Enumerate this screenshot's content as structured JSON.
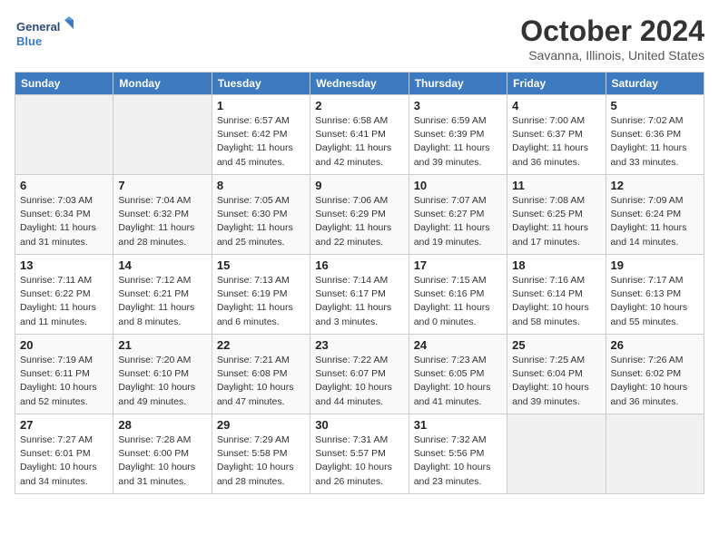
{
  "logo": {
    "line1": "General",
    "line2": "Blue"
  },
  "title": "October 2024",
  "location": "Savanna, Illinois, United States",
  "days_of_week": [
    "Sunday",
    "Monday",
    "Tuesday",
    "Wednesday",
    "Thursday",
    "Friday",
    "Saturday"
  ],
  "weeks": [
    [
      {
        "day": "",
        "empty": true
      },
      {
        "day": "",
        "empty": true
      },
      {
        "day": "1",
        "sunrise": "Sunrise: 6:57 AM",
        "sunset": "Sunset: 6:42 PM",
        "daylight": "Daylight: 11 hours and 45 minutes."
      },
      {
        "day": "2",
        "sunrise": "Sunrise: 6:58 AM",
        "sunset": "Sunset: 6:41 PM",
        "daylight": "Daylight: 11 hours and 42 minutes."
      },
      {
        "day": "3",
        "sunrise": "Sunrise: 6:59 AM",
        "sunset": "Sunset: 6:39 PM",
        "daylight": "Daylight: 11 hours and 39 minutes."
      },
      {
        "day": "4",
        "sunrise": "Sunrise: 7:00 AM",
        "sunset": "Sunset: 6:37 PM",
        "daylight": "Daylight: 11 hours and 36 minutes."
      },
      {
        "day": "5",
        "sunrise": "Sunrise: 7:02 AM",
        "sunset": "Sunset: 6:36 PM",
        "daylight": "Daylight: 11 hours and 33 minutes."
      }
    ],
    [
      {
        "day": "6",
        "sunrise": "Sunrise: 7:03 AM",
        "sunset": "Sunset: 6:34 PM",
        "daylight": "Daylight: 11 hours and 31 minutes."
      },
      {
        "day": "7",
        "sunrise": "Sunrise: 7:04 AM",
        "sunset": "Sunset: 6:32 PM",
        "daylight": "Daylight: 11 hours and 28 minutes."
      },
      {
        "day": "8",
        "sunrise": "Sunrise: 7:05 AM",
        "sunset": "Sunset: 6:30 PM",
        "daylight": "Daylight: 11 hours and 25 minutes."
      },
      {
        "day": "9",
        "sunrise": "Sunrise: 7:06 AM",
        "sunset": "Sunset: 6:29 PM",
        "daylight": "Daylight: 11 hours and 22 minutes."
      },
      {
        "day": "10",
        "sunrise": "Sunrise: 7:07 AM",
        "sunset": "Sunset: 6:27 PM",
        "daylight": "Daylight: 11 hours and 19 minutes."
      },
      {
        "day": "11",
        "sunrise": "Sunrise: 7:08 AM",
        "sunset": "Sunset: 6:25 PM",
        "daylight": "Daylight: 11 hours and 17 minutes."
      },
      {
        "day": "12",
        "sunrise": "Sunrise: 7:09 AM",
        "sunset": "Sunset: 6:24 PM",
        "daylight": "Daylight: 11 hours and 14 minutes."
      }
    ],
    [
      {
        "day": "13",
        "sunrise": "Sunrise: 7:11 AM",
        "sunset": "Sunset: 6:22 PM",
        "daylight": "Daylight: 11 hours and 11 minutes."
      },
      {
        "day": "14",
        "sunrise": "Sunrise: 7:12 AM",
        "sunset": "Sunset: 6:21 PM",
        "daylight": "Daylight: 11 hours and 8 minutes."
      },
      {
        "day": "15",
        "sunrise": "Sunrise: 7:13 AM",
        "sunset": "Sunset: 6:19 PM",
        "daylight": "Daylight: 11 hours and 6 minutes."
      },
      {
        "day": "16",
        "sunrise": "Sunrise: 7:14 AM",
        "sunset": "Sunset: 6:17 PM",
        "daylight": "Daylight: 11 hours and 3 minutes."
      },
      {
        "day": "17",
        "sunrise": "Sunrise: 7:15 AM",
        "sunset": "Sunset: 6:16 PM",
        "daylight": "Daylight: 11 hours and 0 minutes."
      },
      {
        "day": "18",
        "sunrise": "Sunrise: 7:16 AM",
        "sunset": "Sunset: 6:14 PM",
        "daylight": "Daylight: 10 hours and 58 minutes."
      },
      {
        "day": "19",
        "sunrise": "Sunrise: 7:17 AM",
        "sunset": "Sunset: 6:13 PM",
        "daylight": "Daylight: 10 hours and 55 minutes."
      }
    ],
    [
      {
        "day": "20",
        "sunrise": "Sunrise: 7:19 AM",
        "sunset": "Sunset: 6:11 PM",
        "daylight": "Daylight: 10 hours and 52 minutes."
      },
      {
        "day": "21",
        "sunrise": "Sunrise: 7:20 AM",
        "sunset": "Sunset: 6:10 PM",
        "daylight": "Daylight: 10 hours and 49 minutes."
      },
      {
        "day": "22",
        "sunrise": "Sunrise: 7:21 AM",
        "sunset": "Sunset: 6:08 PM",
        "daylight": "Daylight: 10 hours and 47 minutes."
      },
      {
        "day": "23",
        "sunrise": "Sunrise: 7:22 AM",
        "sunset": "Sunset: 6:07 PM",
        "daylight": "Daylight: 10 hours and 44 minutes."
      },
      {
        "day": "24",
        "sunrise": "Sunrise: 7:23 AM",
        "sunset": "Sunset: 6:05 PM",
        "daylight": "Daylight: 10 hours and 41 minutes."
      },
      {
        "day": "25",
        "sunrise": "Sunrise: 7:25 AM",
        "sunset": "Sunset: 6:04 PM",
        "daylight": "Daylight: 10 hours and 39 minutes."
      },
      {
        "day": "26",
        "sunrise": "Sunrise: 7:26 AM",
        "sunset": "Sunset: 6:02 PM",
        "daylight": "Daylight: 10 hours and 36 minutes."
      }
    ],
    [
      {
        "day": "27",
        "sunrise": "Sunrise: 7:27 AM",
        "sunset": "Sunset: 6:01 PM",
        "daylight": "Daylight: 10 hours and 34 minutes."
      },
      {
        "day": "28",
        "sunrise": "Sunrise: 7:28 AM",
        "sunset": "Sunset: 6:00 PM",
        "daylight": "Daylight: 10 hours and 31 minutes."
      },
      {
        "day": "29",
        "sunrise": "Sunrise: 7:29 AM",
        "sunset": "Sunset: 5:58 PM",
        "daylight": "Daylight: 10 hours and 28 minutes."
      },
      {
        "day": "30",
        "sunrise": "Sunrise: 7:31 AM",
        "sunset": "Sunset: 5:57 PM",
        "daylight": "Daylight: 10 hours and 26 minutes."
      },
      {
        "day": "31",
        "sunrise": "Sunrise: 7:32 AM",
        "sunset": "Sunset: 5:56 PM",
        "daylight": "Daylight: 10 hours and 23 minutes."
      },
      {
        "day": "",
        "empty": true
      },
      {
        "day": "",
        "empty": true
      }
    ]
  ]
}
